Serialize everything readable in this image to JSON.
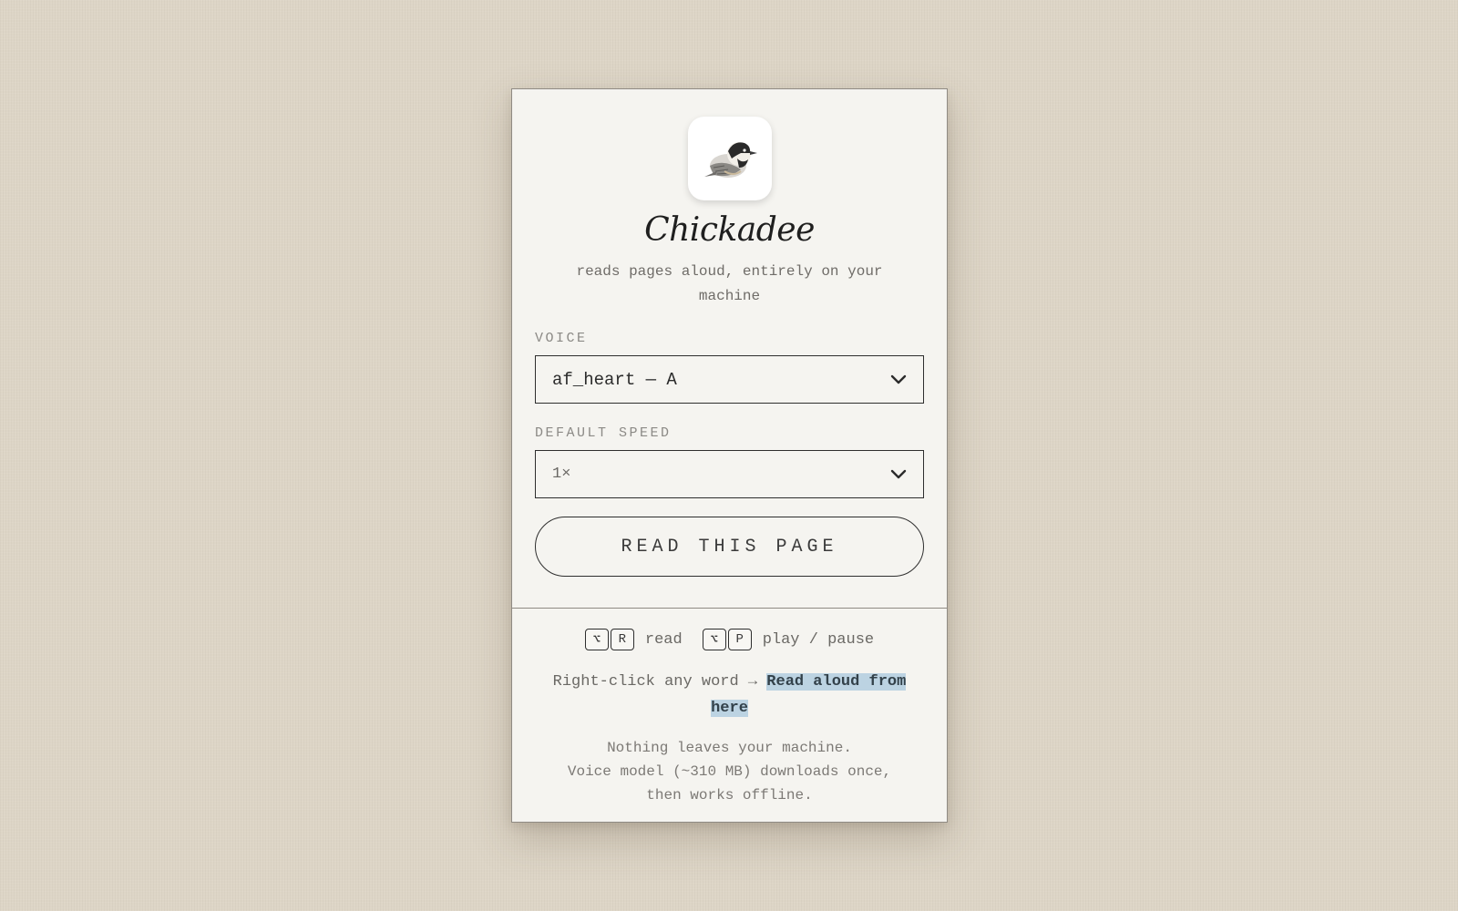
{
  "app": {
    "name": "Chickadee",
    "tagline": "reads pages aloud, entirely on your machine",
    "logo_icon": "chickadee-bird-icon"
  },
  "voice": {
    "label": "VOICE",
    "selected": "af_heart — A"
  },
  "speed": {
    "label": "DEFAULT SPEED",
    "selected": "1×"
  },
  "read_button": {
    "label": "READ THIS PAGE"
  },
  "shortcuts": [
    {
      "keys": [
        "⌥",
        "R"
      ],
      "label": "read"
    },
    {
      "keys": [
        "⌥",
        "P"
      ],
      "label": "play / pause"
    }
  ],
  "tip": {
    "prefix": "Right-click any word → ",
    "highlight": "Read aloud from here"
  },
  "privacy": {
    "line1": "Nothing leaves your machine.",
    "line2": "Voice model (~310 MB) downloads once,",
    "line3": "then works offline."
  },
  "colors": {
    "page_background": "#ddd5c6",
    "panel_background": "#f5f4f0",
    "border": "#2e2e2e",
    "highlight": "#bcd3e2"
  }
}
